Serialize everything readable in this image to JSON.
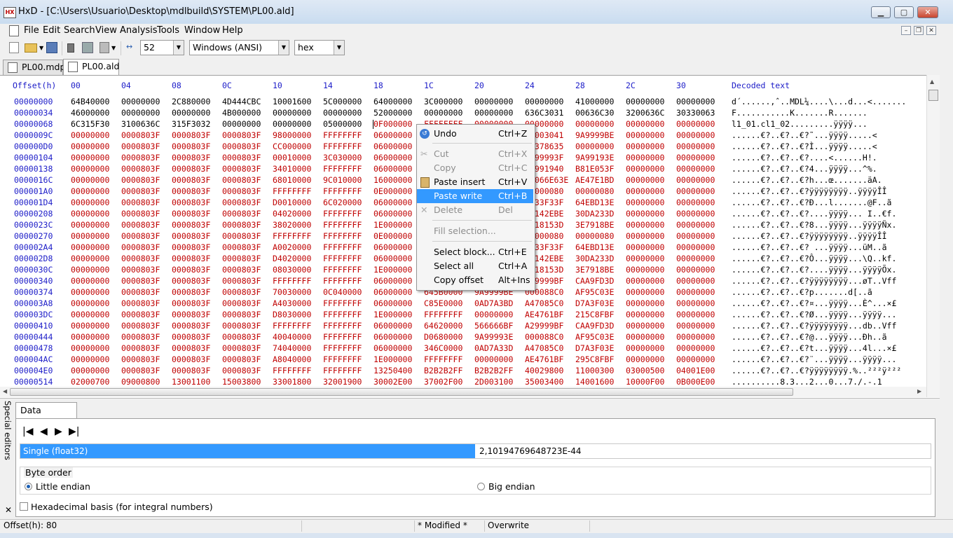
{
  "window": {
    "title": "HxD - [C:\\Users\\Usuario\\Desktop\\mdlbuild\\SYSTEM\\PL00.ald]",
    "app_icon_text": "HX"
  },
  "menu": [
    "File",
    "Edit",
    "Search",
    "View",
    "Analysis",
    "Tools",
    "Window",
    "Help"
  ],
  "toolbar": {
    "bytes_per_row": "52",
    "charset": "Windows (ANSI)",
    "offset_base": "hex"
  },
  "tabs": [
    {
      "label": "PL00.mdp",
      "active": false
    },
    {
      "label": "PL00.ald",
      "active": true
    }
  ],
  "hex": {
    "header": {
      "offset": "Offset(h)",
      "columns": [
        "00",
        "04",
        "08",
        "0C",
        "10",
        "14",
        "18",
        "1C",
        "20",
        "24",
        "28",
        "2C",
        "30"
      ],
      "decoded": "Decoded text"
    },
    "rows": [
      {
        "offset": "00000000",
        "cells": [
          "64B40000",
          "00000000",
          "2C880000",
          "4D444CBC",
          "10001600",
          "5C000000",
          "64000000",
          "3C000000",
          "00000000",
          "00000000",
          "41000000",
          "00000000",
          "00000000"
        ],
        "text": "d´......,ˆ..MDL¼....\\...d...<......."
      },
      {
        "offset": "00000034",
        "cells": [
          "46000000",
          "00000000",
          "00000000",
          "4B000000",
          "00000000",
          "00000000",
          "52000000",
          "00000000",
          "00000000",
          "636C3031",
          "00636C30",
          "3200636C",
          "30330063"
        ],
        "text": "F...........K.......R......."
      },
      {
        "offset": "00000068",
        "cells": [
          "6C315F30",
          "3100636C",
          "315F3032",
          "00000000",
          "00000000",
          "05000000",
          "0F000000",
          "FFFFFFFF",
          "00000000",
          "00000000",
          "00000000",
          "00000000",
          "00000000"
        ],
        "text": "l1_01.cl1_02.........ÿÿÿÿ..."
      },
      {
        "offset": "0000009C",
        "cells": [
          "00000000",
          "0000803F",
          "0000803F",
          "0000803F",
          "98000000",
          "FFFFFFFF",
          "06000000",
          "",
          "",
          "00003041",
          "9A9999BE",
          "00000000",
          "00000000"
        ],
        "text": "......€?..€?..€?˜...ÿÿÿÿ.....<"
      },
      {
        "offset": "000000D0",
        "cells": [
          "00000000",
          "0000803F",
          "0000803F",
          "0000803F",
          "CC000000",
          "FFFFFFFF",
          "06000000",
          "",
          "",
          "00378635",
          "00000000",
          "00000000",
          "00000000"
        ],
        "text": "......€?..€?..€?Ì...ÿÿÿÿ.....<"
      },
      {
        "offset": "00000104",
        "cells": [
          "00000000",
          "0000803F",
          "0000803F",
          "0000803F",
          "00010000",
          "3C030000",
          "06000000",
          "",
          "",
          "9A99993F",
          "9A99193E",
          "00000000",
          "00000000"
        ],
        "text": "......€?..€?..€?....<......H!."
      },
      {
        "offset": "00000138",
        "cells": [
          "00000000",
          "0000803F",
          "0000803F",
          "0000803F",
          "34010000",
          "FFFFFFFF",
          "06000000",
          "",
          "",
          "00991940",
          "B81E053F",
          "00000000",
          "00000000"
        ],
        "text": "......€?..€?..€?4...ÿÿÿÿ...^%."
      },
      {
        "offset": "0000016C",
        "cells": [
          "00000000",
          "0000803F",
          "0000803F",
          "0000803F",
          "68010000",
          "9C010000",
          "16000000",
          "",
          "",
          "00066E63E",
          "AE47E1BD",
          "00000000",
          "00000000"
        ],
        "text": "......€?..€?..€?h...œ.......äA."
      },
      {
        "offset": "000001A0",
        "cells": [
          "00000000",
          "0000803F",
          "0000803F",
          "0000803F",
          "FFFFFFFF",
          "FFFFFFFF",
          "0E000000",
          "",
          "",
          "00000080",
          "00000080",
          "00000000",
          "00000000"
        ],
        "text": "......€?..€?..€?ÿÿÿÿÿÿÿÿ..ÿÿÿÿÎÎ"
      },
      {
        "offset": "000001D4",
        "cells": [
          "00000000",
          "0000803F",
          "0000803F",
          "0000803F",
          "D0010000",
          "6C020000",
          "06000000",
          "",
          "",
          "0033F33F",
          "64EBD13E",
          "00000000",
          "00000000"
        ],
        "text": "......€?..€?..€?Ð...l.......@F..ã"
      },
      {
        "offset": "00000208",
        "cells": [
          "00000000",
          "0000803F",
          "0000803F",
          "0000803F",
          "04020000",
          "FFFFFFFF",
          "06000000",
          "",
          "",
          "00142EBE",
          "30DA233D",
          "00000000",
          "00000000"
        ],
        "text": "......€?..€?..€?....ÿÿÿÿ... I..€f."
      },
      {
        "offset": "0000023C",
        "cells": [
          "00000000",
          "0000803F",
          "0000803F",
          "0000803F",
          "38020000",
          "FFFFFFFF",
          "1E000000",
          "",
          "",
          "0018153D",
          "3E7918BE",
          "00000000",
          "00000000"
        ],
        "text": "......€?..€?..€?8...ÿÿÿÿ...ÿÿÿÿÑx."
      },
      {
        "offset": "00000270",
        "cells": [
          "00000000",
          "0000803F",
          "0000803F",
          "0000803F",
          "FFFFFFFF",
          "FFFFFFFF",
          "0E000000",
          "",
          "",
          "00000080",
          "00000080",
          "00000000",
          "00000000"
        ],
        "text": "......€?..€?..€?ÿÿÿÿÿÿÿÿ..ÿÿÿÿÎÎ"
      },
      {
        "offset": "000002A4",
        "cells": [
          "00000000",
          "0000803F",
          "0000803F",
          "0000803F",
          "A0020000",
          "FFFFFFFF",
          "06000000",
          "",
          "",
          "0033F33F",
          "64EBD13E",
          "00000000",
          "00000000"
        ],
        "text": "......€?..€?..€? ...ÿÿÿÿ...üM..ã"
      },
      {
        "offset": "000002D8",
        "cells": [
          "00000000",
          "0000803F",
          "0000803F",
          "0000803F",
          "D4020000",
          "FFFFFFFF",
          "06000000",
          "",
          "",
          "00142EBE",
          "30DA233D",
          "00000000",
          "00000000"
        ],
        "text": "......€?..€?..€?Ô...ÿÿÿÿ...\\Q..kf."
      },
      {
        "offset": "0000030C",
        "cells": [
          "00000000",
          "0000803F",
          "0000803F",
          "0000803F",
          "08030000",
          "FFFFFFFF",
          "1E000000",
          "",
          "",
          "0018153D",
          "3E7918BE",
          "00000000",
          "00000000"
        ],
        "text": "......€?..€?..€?....ÿÿÿÿ...ÿÿÿÿÕx."
      },
      {
        "offset": "00000340",
        "cells": [
          "00000000",
          "0000803F",
          "0000803F",
          "0000803F",
          "FFFFFFFF",
          "FFFFFFFF",
          "06000000",
          "",
          "",
          "009999BF",
          "CAA9FD3D",
          "00000000",
          "00000000"
        ],
        "text": "......€?..€?..€?ÿÿÿÿÿÿÿÿ...øT..Vff"
      },
      {
        "offset": "00000374",
        "cells": [
          "00000000",
          "0000803F",
          "0000803F",
          "0000803F",
          "70030000",
          "0C040000",
          "06000000",
          "645B0000",
          "9A9999BE",
          "000088C0",
          "AF95C03E",
          "00000000",
          "00000000"
        ],
        "text": "......€?..€?..€?p.......d[..ã"
      },
      {
        "offset": "000003A8",
        "cells": [
          "00000000",
          "0000803F",
          "0000803F",
          "0000803F",
          "A4030000",
          "FFFFFFFF",
          "06000000",
          "C85E0000",
          "0AD7A3BD",
          "A47085C0",
          "D7A3F03E",
          "00000000",
          "00000000"
        ],
        "text": "......€?..€?..€?¤...ÿÿÿÿ...È^...×£"
      },
      {
        "offset": "000003DC",
        "cells": [
          "00000000",
          "0000803F",
          "0000803F",
          "0000803F",
          "D8030000",
          "FFFFFFFF",
          "1E000000",
          "FFFFFFFF",
          "00000000",
          "AE4761BF",
          "215C8FBF",
          "00000000",
          "00000000"
        ],
        "text": "......€?..€?..€?Ø...ÿÿÿÿ...ÿÿÿÿ..."
      },
      {
        "offset": "00000410",
        "cells": [
          "00000000",
          "0000803F",
          "0000803F",
          "0000803F",
          "FFFFFFFF",
          "FFFFFFFF",
          "06000000",
          "64620000",
          "566666BF",
          "A29999BF",
          "CAA9FD3D",
          "00000000",
          "00000000"
        ],
        "text": "......€?..€?..€?ÿÿÿÿÿÿÿÿ...db..Vff"
      },
      {
        "offset": "00000444",
        "cells": [
          "00000000",
          "0000803F",
          "0000803F",
          "0000803F",
          "40040000",
          "FFFFFFFF",
          "06000000",
          "D0680000",
          "9A99993E",
          "000088C0",
          "AF95C03E",
          "00000000",
          "00000000"
        ],
        "text": "......€?..€?..€?@...ÿÿÿÿ...Ðh..ã"
      },
      {
        "offset": "00000478",
        "cells": [
          "00000000",
          "0000803F",
          "0000803F",
          "0000803F",
          "74040000",
          "FFFFFFFF",
          "06000000",
          "346C0000",
          "0AD7A33D",
          "A47085C0",
          "D7A3F03E",
          "00000000",
          "00000000"
        ],
        "text": "......€?..€?..€?t...ÿÿÿÿ...4l...×£"
      },
      {
        "offset": "000004AC",
        "cells": [
          "00000000",
          "0000803F",
          "0000803F",
          "0000803F",
          "A8040000",
          "FFFFFFFF",
          "1E000000",
          "FFFFFFFF",
          "00000000",
          "AE4761BF",
          "295C8FBF",
          "00000000",
          "00000000"
        ],
        "text": "......€?..€?..€?¨...ÿÿÿÿ...ÿÿÿÿ..."
      },
      {
        "offset": "000004E0",
        "cells": [
          "00000000",
          "0000803F",
          "0000803F",
          "0000803F",
          "FFFFFFFF",
          "FFFFFFFF",
          "13250400",
          "B2B2B2FF",
          "B2B2B2FF",
          "40029800",
          "11000300",
          "03000500",
          "04001E00"
        ],
        "text": "......€?..€?..€?ÿÿÿÿÿÿÿÿ.%..²²²ÿ²²²"
      },
      {
        "offset": "00000514",
        "cells": [
          "02000700",
          "09000800",
          "13001100",
          "15003800",
          "33001800",
          "32001900",
          "30002E00",
          "37002F00",
          "2D003100",
          "35003400",
          "14001600",
          "10000F00",
          "0B000E00"
        ],
        "text": "..........8.3...2...0...7./.-.1"
      }
    ]
  },
  "context_menu": {
    "items": [
      {
        "label": "Undo",
        "shortcut": "Ctrl+Z",
        "disabled": false,
        "icon": "undo-icon"
      },
      {
        "label": "Cut",
        "shortcut": "Ctrl+X",
        "disabled": true,
        "icon": "cut-icon"
      },
      {
        "label": "Copy",
        "shortcut": "Ctrl+C",
        "disabled": true,
        "icon": "copy-icon"
      },
      {
        "label": "Paste insert",
        "shortcut": "Ctrl+V",
        "disabled": false,
        "icon": "paste-icon"
      },
      {
        "label": "Paste write",
        "shortcut": "Ctrl+B",
        "disabled": false,
        "selected": true
      },
      {
        "label": "Delete",
        "shortcut": "Del",
        "disabled": true,
        "icon": "delete-icon"
      },
      {
        "label": "Fill selection...",
        "shortcut": "",
        "disabled": true
      },
      {
        "label": "Select block...",
        "shortcut": "Ctrl+E",
        "disabled": false
      },
      {
        "label": "Select all",
        "shortcut": "Ctrl+A",
        "disabled": false
      },
      {
        "label": "Copy offset",
        "shortcut": "Alt+Ins",
        "disabled": false
      }
    ]
  },
  "lower_panel": {
    "side_label": "Special editors",
    "tab_label": "Data inspector",
    "type_label": "Single (float32)",
    "type_value": "2,10194769648723E-44",
    "byte_order_label": "Byte order",
    "little_endian_label": "Little endian",
    "big_endian_label": "Big endian",
    "little_endian_selected": true,
    "hex_basis_label": "Hexadecimal basis (for integral numbers)",
    "hex_basis_checked": false
  },
  "status": {
    "offset": "Offset(h): 80",
    "modified": "* Modified *",
    "mode": "Overwrite"
  }
}
